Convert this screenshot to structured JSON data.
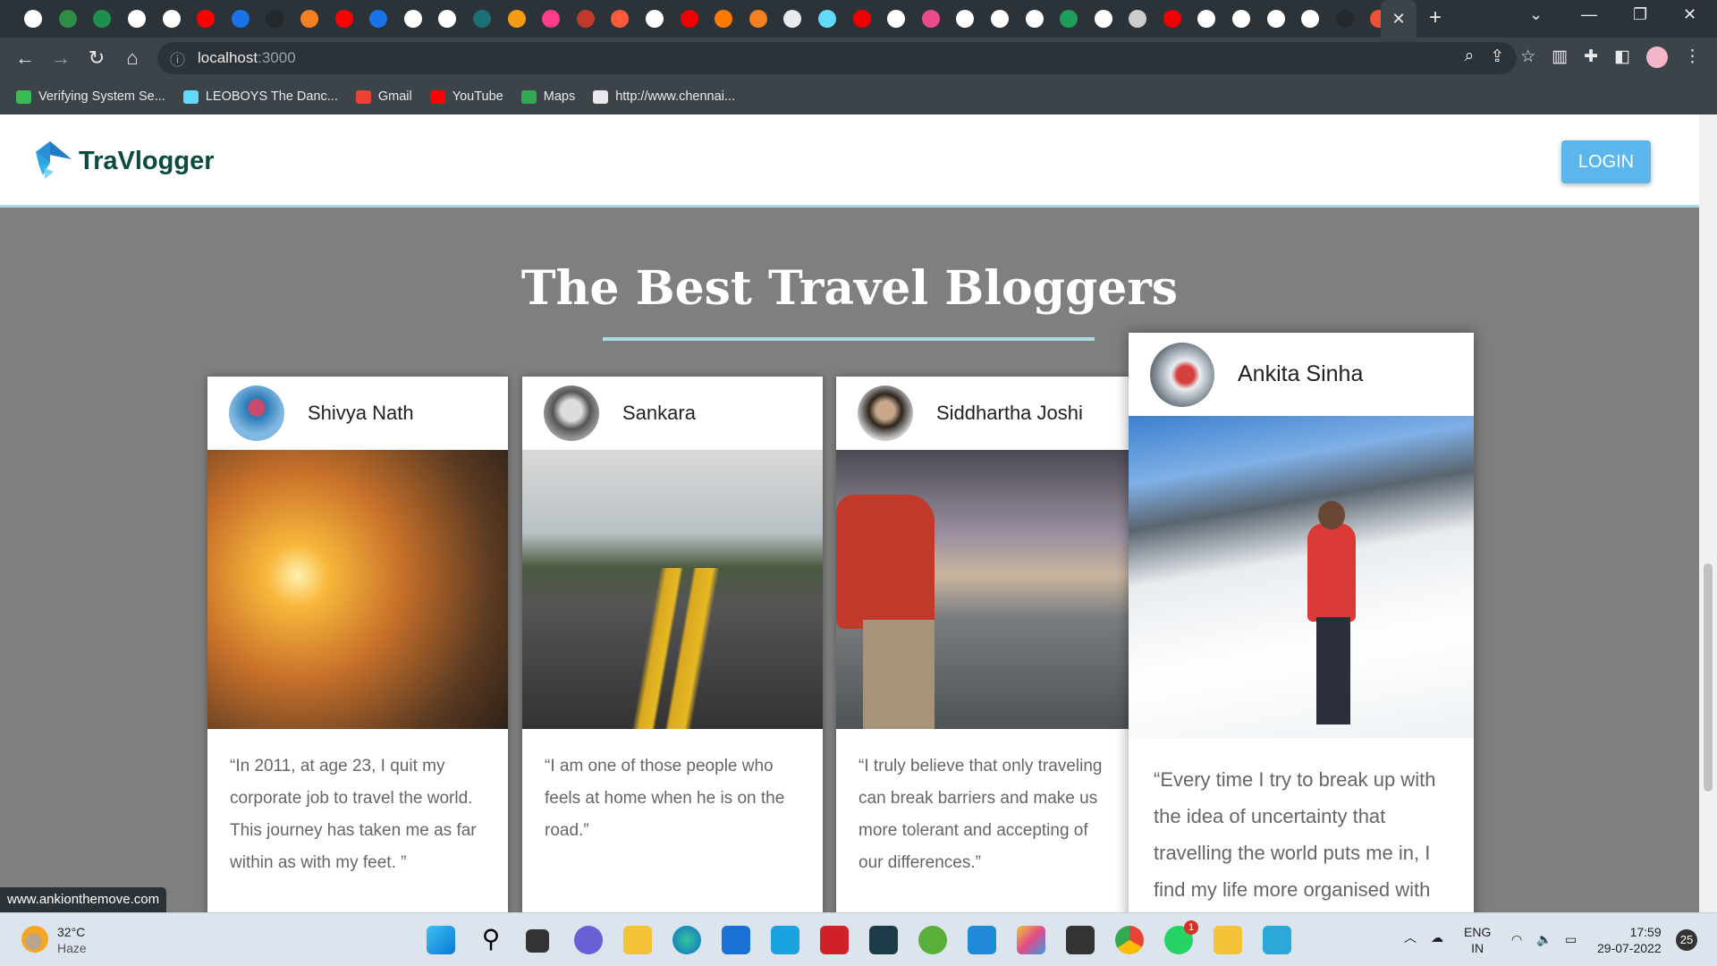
{
  "browser": {
    "tab_favicons": [
      {
        "name": "google",
        "c": "#fff"
      },
      {
        "name": "geeksforgeeks",
        "c": "#2f8d46"
      },
      {
        "name": "alt",
        "c": "#1e8f4e"
      },
      {
        "name": "google",
        "c": "#fff"
      },
      {
        "name": "globe",
        "c": "#fff"
      },
      {
        "name": "youtube",
        "c": "#f00"
      },
      {
        "name": "f-logo",
        "c": "#1a73e8"
      },
      {
        "name": "github",
        "c": "#24292e"
      },
      {
        "name": "stackoverflow",
        "c": "#f48024"
      },
      {
        "name": "youtube",
        "c": "#f00"
      },
      {
        "name": "mj",
        "c": "#1a73e8"
      },
      {
        "name": "google",
        "c": "#fff"
      },
      {
        "name": "google",
        "c": "#fff"
      },
      {
        "name": "kp",
        "c": "#1b6f75"
      },
      {
        "name": "sp",
        "c": "#f39c12"
      },
      {
        "name": "butterfly",
        "c": "#ff3d8b"
      },
      {
        "name": "dots",
        "c": "#c0392b"
      },
      {
        "name": "fsg",
        "c": "#ff5a3c"
      },
      {
        "name": "chrome",
        "c": "#fff"
      },
      {
        "name": "pdf",
        "c": "#e00"
      },
      {
        "name": "blogger",
        "c": "#ff7a00"
      },
      {
        "name": "stackoverflow",
        "c": "#f48024"
      },
      {
        "name": "puzzle",
        "c": "#e8eaed"
      },
      {
        "name": "react",
        "c": "#61dafb"
      },
      {
        "name": "pdf",
        "c": "#e00"
      },
      {
        "name": "google",
        "c": "#fff"
      },
      {
        "name": "dribbble",
        "c": "#ea4c89"
      },
      {
        "name": "globe",
        "c": "#fff"
      },
      {
        "name": "globe",
        "c": "#fff"
      },
      {
        "name": "google",
        "c": "#fff"
      },
      {
        "name": "m-logo",
        "c": "#1e9e5a"
      },
      {
        "name": "globe",
        "c": "#fff"
      },
      {
        "name": "w-logo",
        "c": "#ccc"
      },
      {
        "name": "pdf",
        "c": "#e00"
      },
      {
        "name": "google",
        "c": "#fff"
      },
      {
        "name": "globe",
        "c": "#fff"
      },
      {
        "name": "f-box",
        "c": "#fff"
      },
      {
        "name": "codepen",
        "c": "#fff"
      },
      {
        "name": "github",
        "c": "#24292e"
      },
      {
        "name": "git",
        "c": "#f05033"
      }
    ],
    "url_host": "localhost",
    "url_port": ":3000",
    "bookmarks": [
      {
        "label": "Verifying System Se...",
        "c": "#3cba54"
      },
      {
        "label": "LEOBOYS The Danc...",
        "c": "#61dafb"
      },
      {
        "label": "Gmail",
        "c": "#ea4335"
      },
      {
        "label": "YouTube",
        "c": "#f00"
      },
      {
        "label": "Maps",
        "c": "#34a853"
      },
      {
        "label": "http://www.chennai...",
        "c": "#e8eaed"
      }
    ]
  },
  "site": {
    "brand": "TraVlogger",
    "login": "LOGIN",
    "title": "The Best Travel Bloggers",
    "accent": "#a8dbe6",
    "bloggers": [
      {
        "name": "Shivya Nath",
        "quote": "“In 2011, at age 23, I quit my corporate job to travel the world. This journey has taken me as far within as with my feet. ”"
      },
      {
        "name": "Sankara",
        "quote": "“I am one of those people who feels at home when he is on the road.”"
      },
      {
        "name": "Siddhartha Joshi",
        "quote": "“I truly believe that only traveling can break barriers and make us more tolerant and accepting of our differences.”"
      },
      {
        "name": "Ankita Sinha",
        "quote": "“Every time I try to break up with the idea of uncertainty that travelling the world puts me in, I find my life more organised with"
      }
    ],
    "status_url": "www.ankionthemove.com"
  },
  "taskbar": {
    "temp": "32°C",
    "weather": "Haze",
    "lang1": "ENG",
    "lang2": "IN",
    "time": "17:59",
    "date": "29-07-2022",
    "notifications": "25",
    "whatsapp_badge": "1"
  }
}
